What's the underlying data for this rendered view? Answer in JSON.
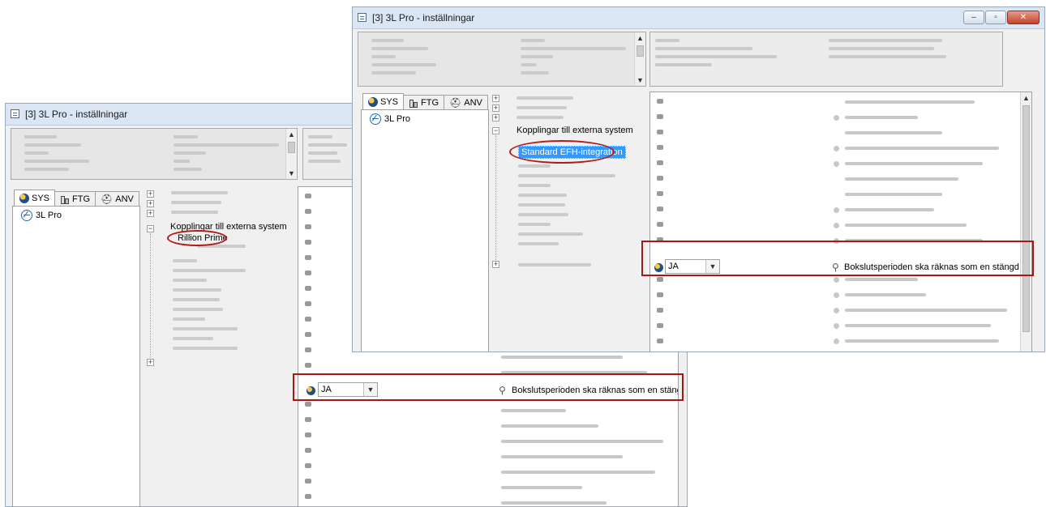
{
  "window_title": "[3]  3L Pro - inställningar",
  "title_controls": {
    "minimize": "–",
    "maximize": "▫",
    "close": "✕"
  },
  "tabs": [
    {
      "label": "SYS",
      "icon": "globe-icon"
    },
    {
      "label": "FTG",
      "icon": "building-icon"
    },
    {
      "label": "ANV",
      "icon": "user-icon"
    }
  ],
  "tree_root_label": "3L Pro",
  "tree_node_external": "Kopplingar till externa system",
  "back_window": {
    "highlighted_node": "Rillion Prime",
    "setting": {
      "value": "JA",
      "description": "Bokslutsperioden ska räknas som en stängd period"
    }
  },
  "front_window": {
    "highlighted_node": "Standard EFH-integration",
    "setting": {
      "value": "JA",
      "description": "Bokslutsperioden ska räknas som en stängd period"
    }
  },
  "colors": {
    "annotation_red": "#a81616",
    "selection_blue": "#3399ff",
    "titlebar": "#dbe6f4"
  }
}
